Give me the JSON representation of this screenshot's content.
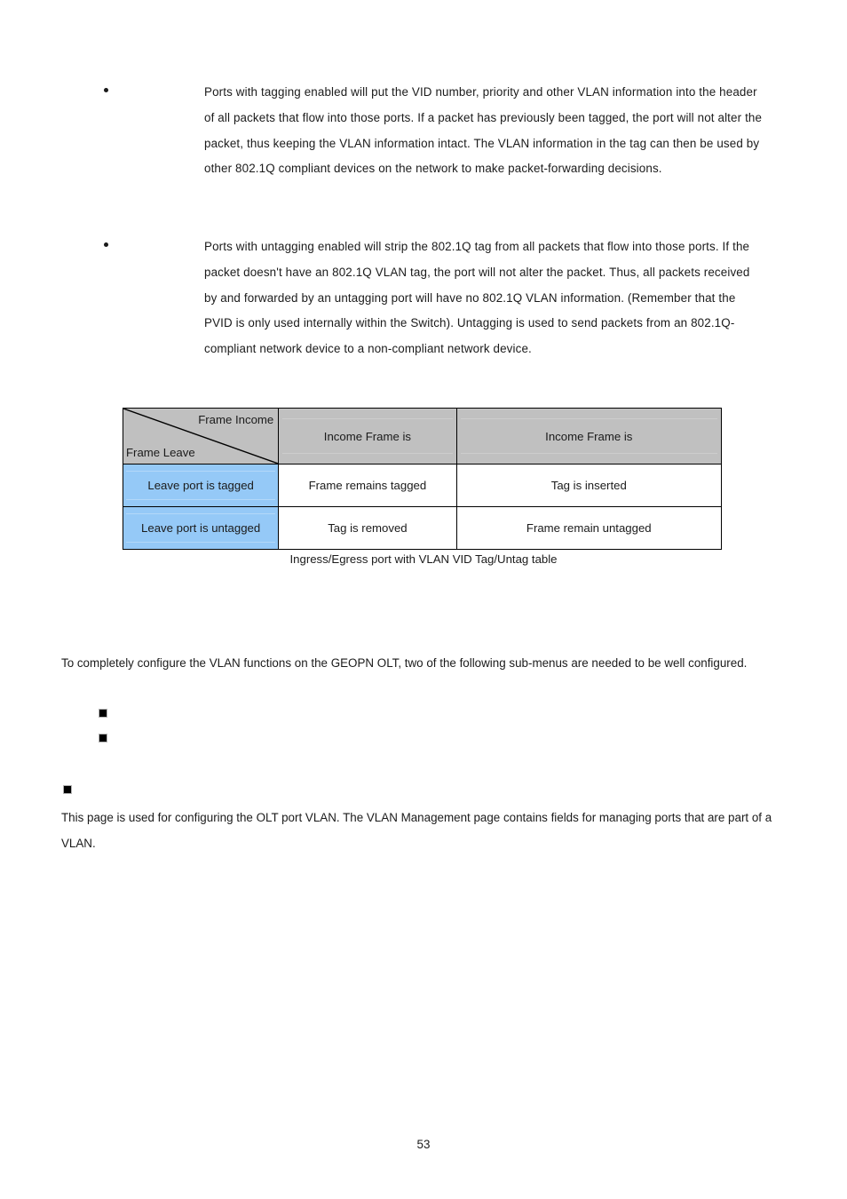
{
  "document": {
    "page_number": "53"
  },
  "bullets": [
    {
      "marker": "bullet-dot",
      "text": "Ports with tagging enabled will put the VID number, priority and other VLAN information into the header of all packets that flow into those ports. If a packet has previously been tagged, the port will not alter the packet, thus keeping the VLAN information intact. The VLAN information in the tag can then be used by other 802.1Q compliant devices on the network to make packet-forwarding decisions."
    },
    {
      "marker": "bullet-dot",
      "text": "Ports with untagging enabled will strip the 802.1Q tag from all packets that flow into those ports. If the packet doesn't have an 802.1Q VLAN tag, the port will not alter the packet. Thus, all packets received by and forwarded by an untagging port will have no 802.1Q VLAN information. (Remember that the PVID is only used internally within the Switch). Untagging is used to send packets from an 802.1Q-compliant network device to a non-compliant network device."
    }
  ],
  "matrix_table": {
    "corner": {
      "top_right_label": "Frame Income",
      "bottom_left_label": "Frame Leave"
    },
    "column_headers": [
      "Income Frame is",
      "Income Frame is"
    ],
    "rows": [
      {
        "label": "Leave port is tagged",
        "cells": [
          "Frame remains tagged",
          "Tag is inserted"
        ]
      },
      {
        "label": "Leave port is untagged",
        "cells": [
          "Tag is removed",
          "Frame remain untagged"
        ]
      }
    ],
    "caption": "Ingress/Egress port with VLAN VID Tag/Untag table",
    "colors": {
      "header_fill": "#c0c0c0",
      "row_label_fill": "#95c9f7",
      "cell_fill": "#ffffff",
      "border": "#000000"
    }
  },
  "body": {
    "intro_paragraph": "To completely configure the VLAN functions on the GEOPN OLT, two of the following sub-menus are needed to be well configured.",
    "sub_menu_items": [
      "",
      ""
    ],
    "section_marker": "",
    "section_paragraph": "This page is used for configuring the OLT port VLAN. The VLAN Management page contains fields for managing ports that are part of a VLAN."
  }
}
